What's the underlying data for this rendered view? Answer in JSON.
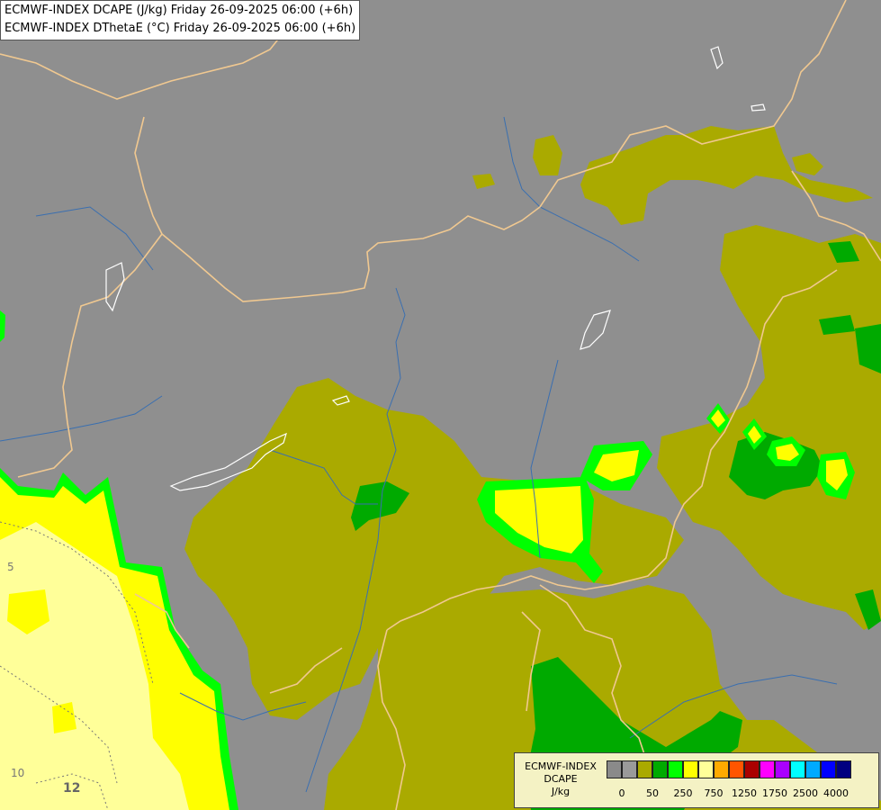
{
  "header": {
    "line1": "ECMWF-INDEX DCAPE (J/kg) Friday 26-09-2025 06:00 (+6h)",
    "line2": "ECMWF-INDEX DThetaE (°C) Friday 26-09-2025 06:00 (+6h)"
  },
  "legend": {
    "line1": "ECMWF-INDEX",
    "line2": "DCAPE",
    "line3": "J/kg",
    "colors": [
      "#8a8a8a",
      "#9a9a9a",
      "#aaaa00",
      "#00aa00",
      "#00ff00",
      "#ffff00",
      "#ffff99",
      "#ffaa00",
      "#ff5500",
      "#aa0000",
      "#ff00ff",
      "#aa00ff",
      "#00ffff",
      "#00aaff",
      "#0000ff",
      "#000080"
    ],
    "ticks": [
      "0",
      "50",
      "250",
      "750",
      "1250",
      "1750",
      "2500",
      "4000"
    ]
  },
  "map_labels": {
    "contour_a": "5",
    "contour_b": "10",
    "contour_c": "12"
  },
  "colors": {
    "background": "#8f8f8f",
    "border": "#f0c890",
    "river": "#3a6fb0",
    "olive": "#aaaa00",
    "green": "#00aa00",
    "bright_green": "#00ff00",
    "yellow": "#ffff00",
    "pale_yellow": "#ffff99"
  }
}
